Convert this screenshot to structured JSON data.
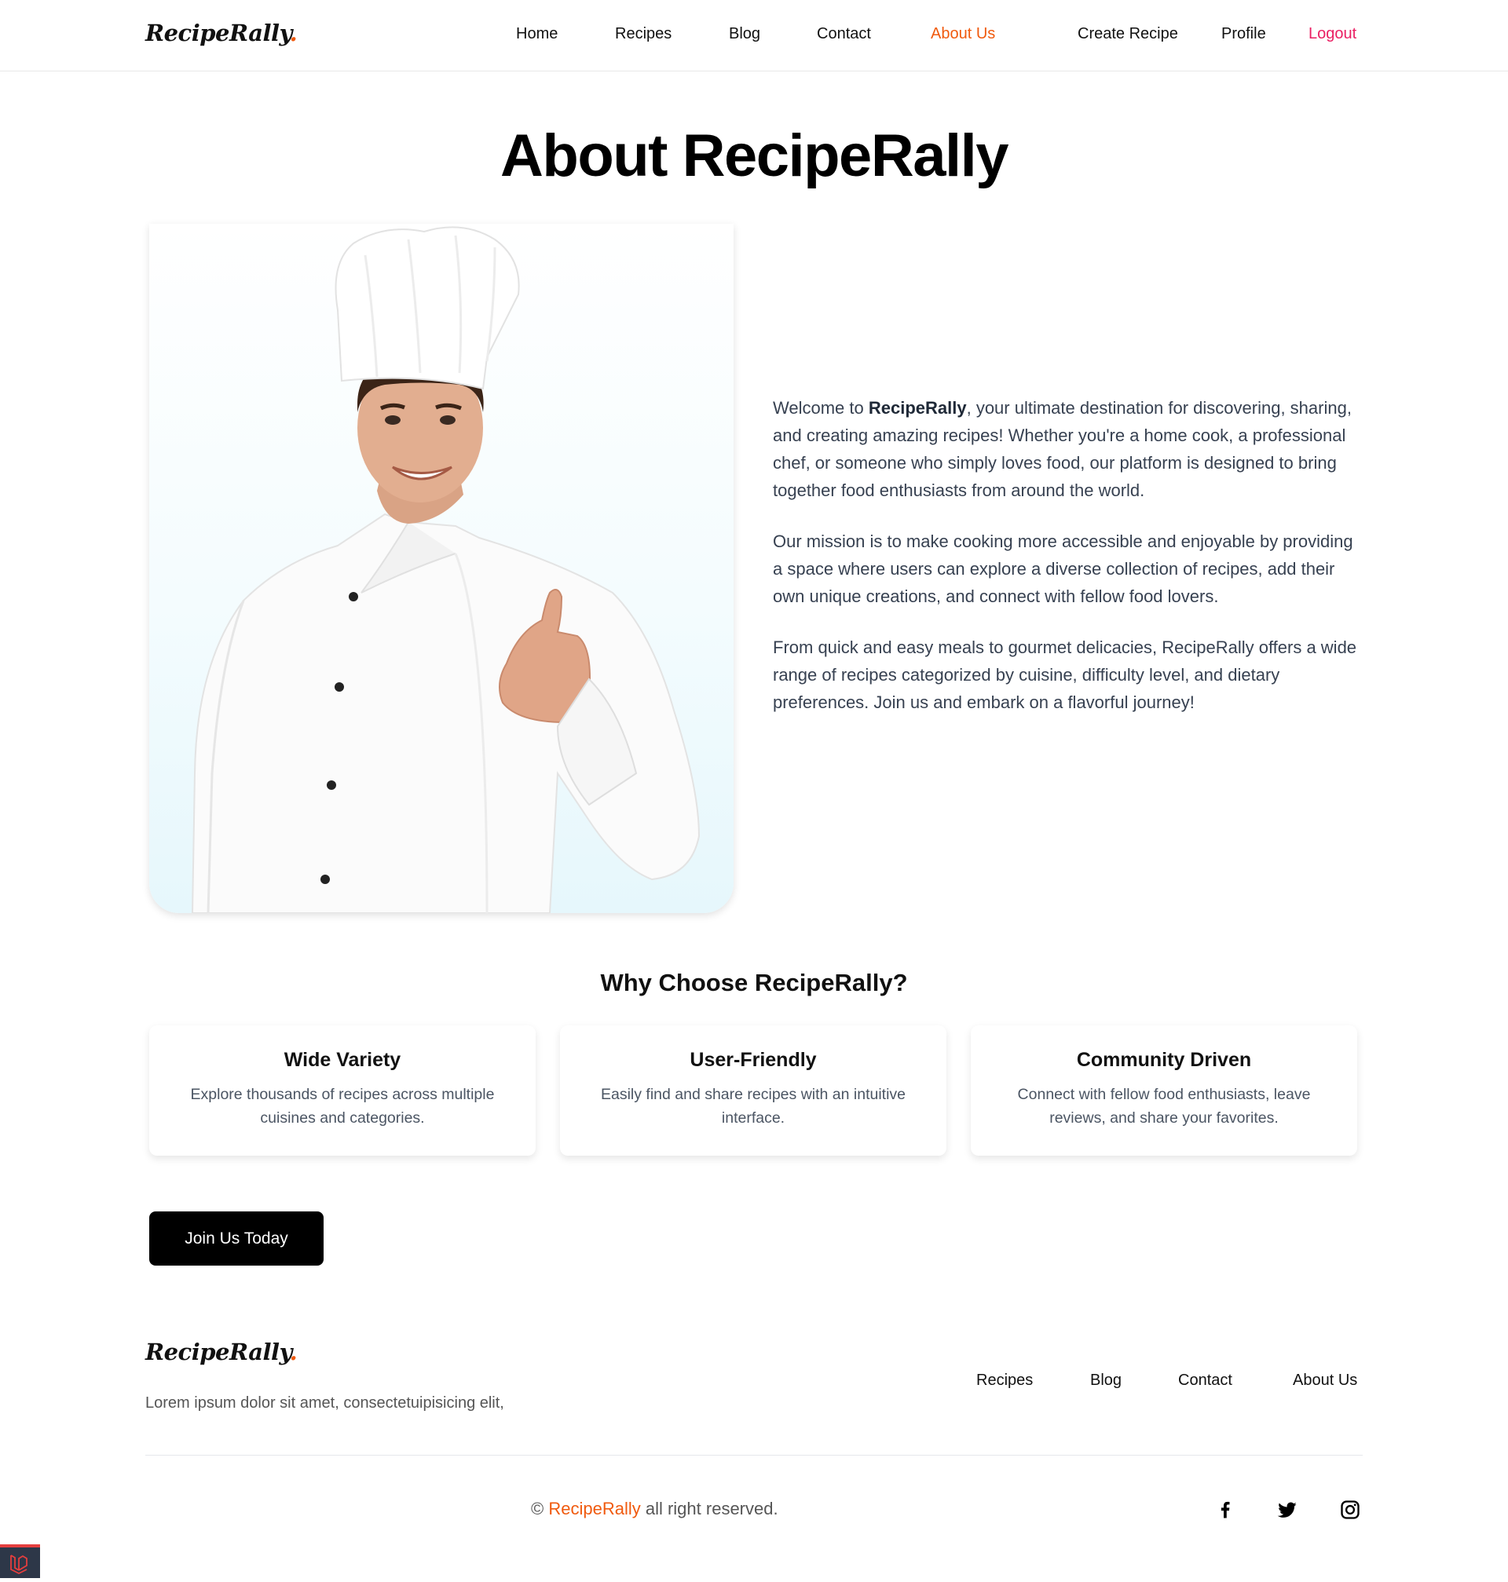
{
  "brand": {
    "logo_text": "RecipeRally",
    "logo_dot": ".",
    "accent_color": "#f05a0e",
    "logout_color": "#ea1f63"
  },
  "nav": {
    "items": [
      "Home",
      "Recipes",
      "Blog",
      "Contact",
      "About Us"
    ],
    "active": "About Us",
    "create_recipe": "Create Recipe",
    "profile": "Profile",
    "logout": "Logout"
  },
  "page": {
    "title": "About RecipeRally",
    "paragraph1": {
      "prefix": "Welcome to ",
      "bold": "RecipeRally",
      "suffix": ", your ultimate destination for discovering, sharing, and creating amazing recipes! Whether you're a home cook, a professional chef, or someone who simply loves food, our platform is designed to bring together food enthusiasts from around the world."
    },
    "paragraph2": "Our mission is to make cooking more accessible and enjoyable by providing a space where users can explore a diverse collection of recipes, add their own unique creations, and connect with fellow food lovers.",
    "paragraph3": "From quick and easy meals to gourmet delicacies, RecipeRally offers a wide range of recipes categorized by cuisine, difficulty level, and dietary preferences. Join us and embark on a flavorful journey!"
  },
  "why": {
    "title": "Why Choose RecipeRally?",
    "features": [
      {
        "title": "Wide Variety",
        "desc": "Explore thousands of recipes across multiple cuisines and categories."
      },
      {
        "title": "User-Friendly",
        "desc": "Easily find and share recipes with an intuitive interface."
      },
      {
        "title": "Community Driven",
        "desc": "Connect with fellow food enthusiasts, leave reviews, and share your favorites."
      }
    ]
  },
  "cta": {
    "label": "Join Us Today"
  },
  "footer": {
    "description": "Lorem ipsum dolor sit amet, consectetuipisicing elit,",
    "links": [
      "Recipes",
      "Blog",
      "Contact",
      "About Us"
    ],
    "copyright_symbol": "©",
    "copyright_brand": "RecipeRally",
    "copyright_suffix": " all right reserved.",
    "social_icons": [
      "facebook-icon",
      "twitter-icon",
      "instagram-icon"
    ]
  }
}
